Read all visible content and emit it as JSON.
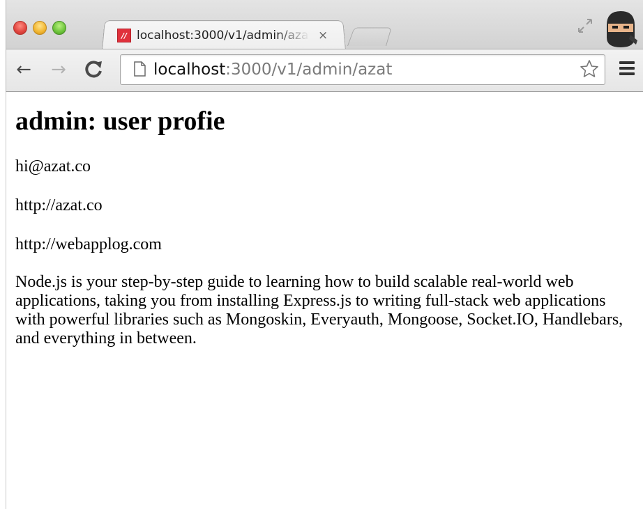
{
  "browser": {
    "tab": {
      "favicon_text": "//",
      "title": "localhost:3000/v1/admin/azat",
      "close_glyph": "×",
      "favicon_color": "#e0313c"
    },
    "address_bar": {
      "host": "localhost",
      "path": ":3000/v1/admin/azat"
    },
    "icons": {
      "back": "back-arrow-icon",
      "forward": "forward-arrow-icon",
      "reload": "reload-icon",
      "page": "page-icon",
      "bookmark": "star-icon",
      "menu": "hamburger-menu-icon",
      "fullscreen": "fullscreen-icon",
      "profile": "ninja-avatar-icon"
    }
  },
  "page": {
    "heading": "admin: user profie",
    "email": "hi@azat.co",
    "website": "http://azat.co",
    "blog": "http://webapplog.com",
    "bio": "Node.js is your step-by-step guide to learning how to build scalable real-world web applications, taking you from installing Express.js to writing full-stack web applications with powerful libraries such as Mongoskin, Everyauth, Mongoose, Socket.IO, Handlebars, and everything in between."
  }
}
